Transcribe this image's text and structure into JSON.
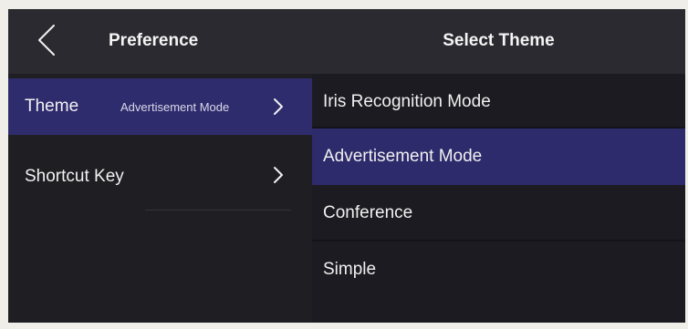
{
  "header": {
    "left_title": "Preference",
    "right_title": "Select Theme",
    "back_icon": "chevron-left-icon"
  },
  "menu": {
    "items": [
      {
        "label": "Theme",
        "value": "Advertisement Mode",
        "selected": true,
        "icon": "chevron-right-icon"
      },
      {
        "label": "Shortcut Key",
        "value": "",
        "selected": false,
        "icon": "chevron-right-icon"
      }
    ]
  },
  "themes": {
    "options": [
      {
        "label": "Iris Recognition Mode",
        "selected": false
      },
      {
        "label": "Advertisement Mode",
        "selected": true
      },
      {
        "label": "Conference",
        "selected": false
      },
      {
        "label": "Simple",
        "selected": false
      }
    ]
  },
  "colors": {
    "selected_background": "#2f2c6e",
    "header_background": "#2b2a30",
    "panel_background": "#1f1e23",
    "text": "#f2f2f2"
  }
}
